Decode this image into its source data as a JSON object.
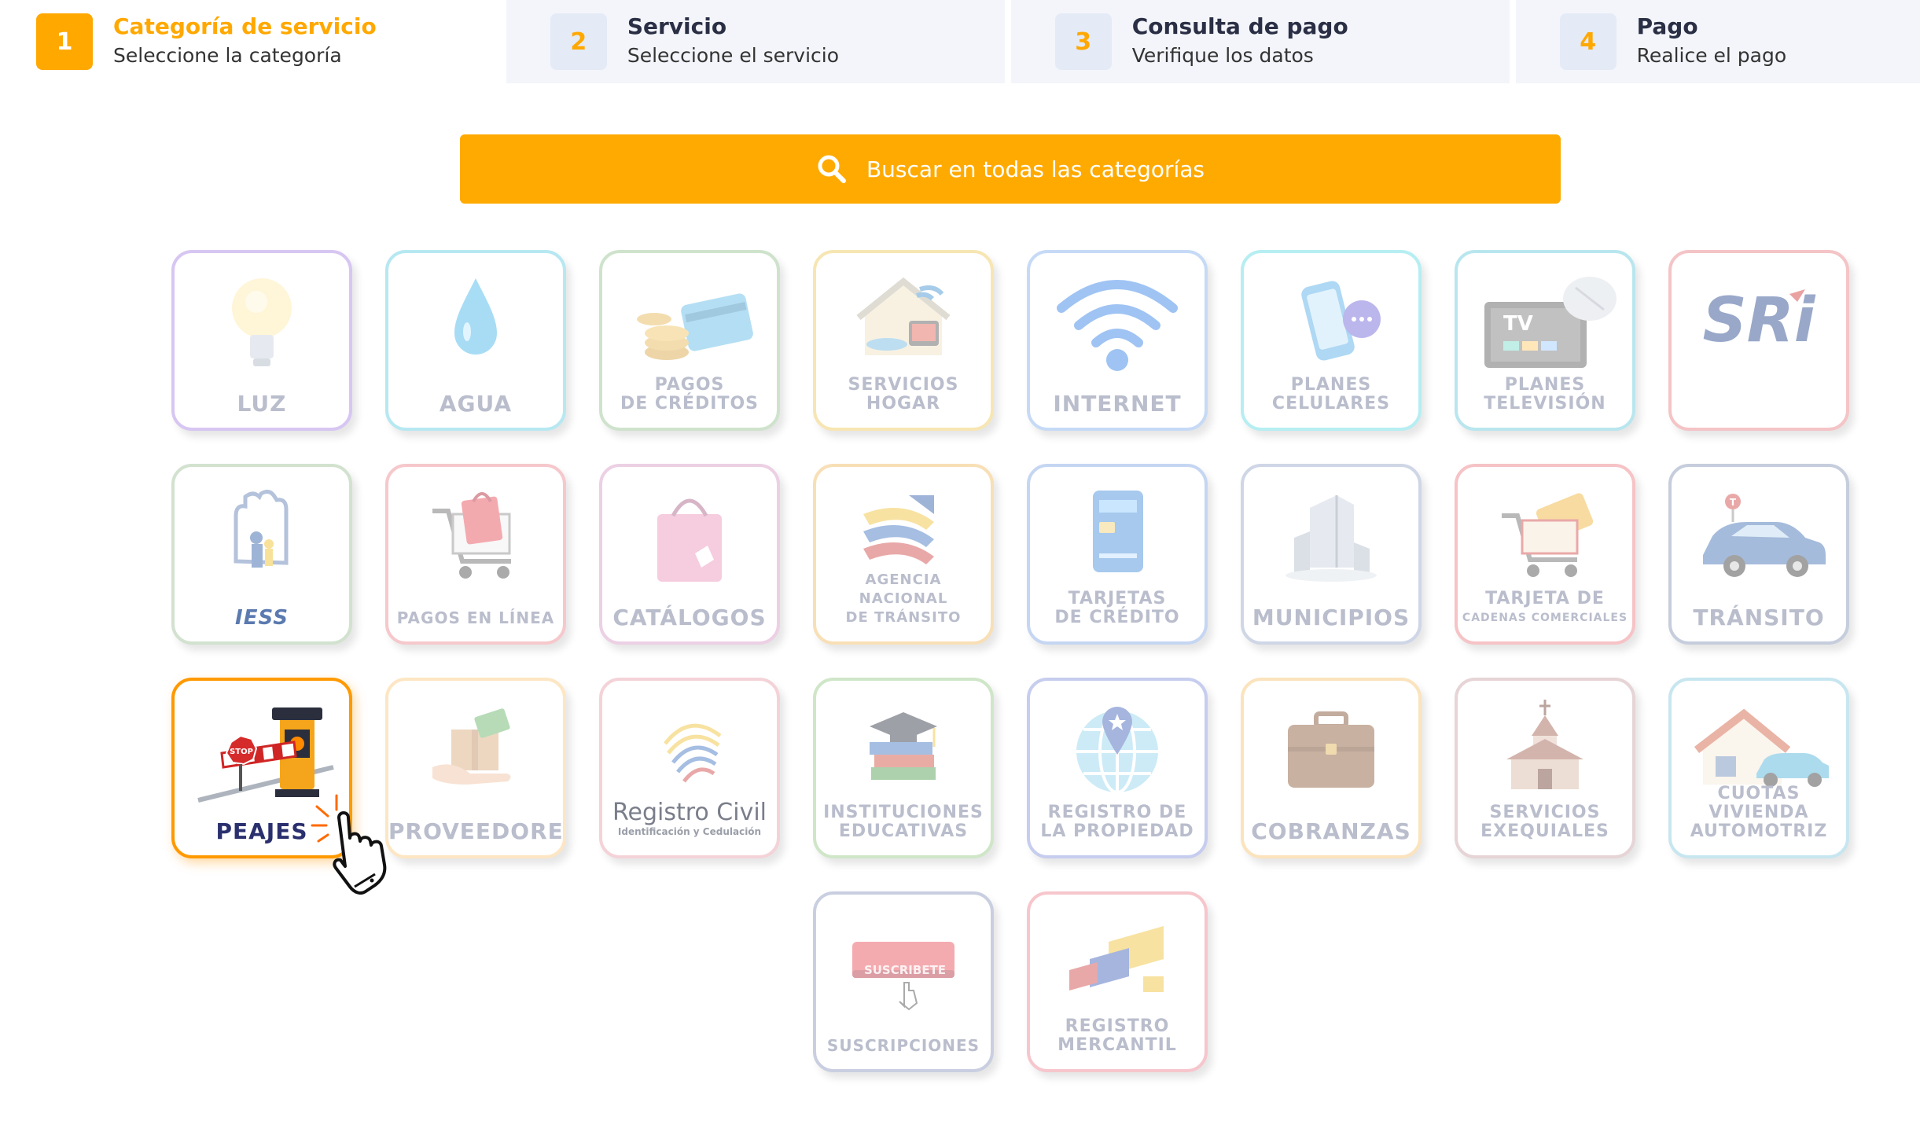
{
  "stepper": {
    "steps": [
      {
        "number": "1",
        "title": "Categoría de servicio",
        "subtitle": "Seleccione la categoría"
      },
      {
        "number": "2",
        "title": "Servicio",
        "subtitle": "Seleccione el servicio"
      },
      {
        "number": "3",
        "title": "Consulta de pago",
        "subtitle": "Verifique los datos"
      },
      {
        "number": "4",
        "title": "Pago",
        "subtitle": "Realice el pago"
      }
    ],
    "active_step": "1"
  },
  "search": {
    "placeholder": "Buscar en todas las categorías",
    "icon": "search-icon"
  },
  "colors": {
    "accent": "#ffa800",
    "search_bg": "#ffaa00",
    "selected_label": "#2a2f6e"
  },
  "categories": [
    {
      "id": "luz",
      "line1": "LUZ",
      "line2": "",
      "icon": "lightbulb-icon",
      "border": "#d7c6f2"
    },
    {
      "id": "agua",
      "line1": "AGUA",
      "line2": "",
      "icon": "water-drop-icon",
      "border": "#b7e8f2"
    },
    {
      "id": "pagos-creditos",
      "line1": "PAGOS",
      "line2": "DE CRÉDITOS",
      "icon": "coins-card-icon",
      "border": "#cfe3cc"
    },
    {
      "id": "servicios-hogar",
      "line1": "SERVICIOS",
      "line2": "HOGAR",
      "icon": "home-services-icon",
      "border": "#f7e6b3"
    },
    {
      "id": "internet",
      "line1": "INTERNET",
      "line2": "",
      "icon": "wifi-icon",
      "border": "#c6daf6"
    },
    {
      "id": "planes-celulares",
      "line1": "PLANES",
      "line2": "CELULARES",
      "icon": "phone-chat-icon",
      "border": "#b6eef2"
    },
    {
      "id": "planes-television",
      "line1": "PLANES",
      "line2": "TELEVISIÓN",
      "icon": "tv-satellite-icon",
      "border": "#b9e6ee"
    },
    {
      "id": "sri",
      "line1": "",
      "line2": "",
      "logo": "SRi",
      "icon": "sri-logo-icon",
      "border": "#f4c4c6"
    },
    {
      "id": "iess",
      "line1": "",
      "line2": "",
      "logo": "IESS",
      "icon": "iess-logo-icon",
      "border": "#d2e2cf"
    },
    {
      "id": "pagos-linea",
      "line1": "PAGOS EN LÍNEA",
      "line2": "",
      "icon": "shopping-cart-icon",
      "border": "#f6c8cc"
    },
    {
      "id": "catalogos",
      "line1": "CATÁLOGOS",
      "line2": "",
      "icon": "shopping-bag-icon",
      "border": "#ecd0e4"
    },
    {
      "id": "ant",
      "line1": "AGENCIA",
      "line2": "NACIONAL",
      "line3": "DE TRÁNSITO",
      "icon": "ant-logo-icon",
      "border": "#f8dfb6"
    },
    {
      "id": "tarjetas-credito",
      "line1": "TARJETAS",
      "line2": "DE CRÉDITO",
      "icon": "credit-card-icon",
      "border": "#c5d6f2"
    },
    {
      "id": "municipios",
      "line1": "MUNICIPIOS",
      "line2": "",
      "icon": "building-icon",
      "border": "#cfd6e6"
    },
    {
      "id": "tarjeta-cadenas",
      "line1": "TARJETA DE",
      "line2": "CADENAS COMERCIALES",
      "icon": "cart-card-icon",
      "border": "#f6c3c6"
    },
    {
      "id": "transito",
      "line1": "TRÁNSITO",
      "line2": "",
      "icon": "car-icon",
      "border": "#c6cddc"
    },
    {
      "id": "peajes",
      "line1": "PEAJES",
      "line2": "",
      "icon": "toll-barrier-icon",
      "border": "#ff9900",
      "selected": true
    },
    {
      "id": "proveedores",
      "line1": "PROVEEDORES",
      "line2": "",
      "icon": "box-hand-icon",
      "border": "#fde6c3"
    },
    {
      "id": "registro-civil",
      "line1": "",
      "line2": "",
      "logo": "Registro Civil",
      "logo_sub": "Identificación y Cedulación",
      "icon": "fingerprint-icon",
      "border": "#f4d3d8"
    },
    {
      "id": "instituciones-educativas",
      "line1": "INSTITUCIONES",
      "line2": "EDUCATIVAS",
      "icon": "graduation-books-icon",
      "border": "#cfe6c8"
    },
    {
      "id": "registro-propiedad",
      "line1": "REGISTRO DE",
      "line2": "LA PROPIEDAD",
      "icon": "globe-pin-icon",
      "border": "#c6cdee"
    },
    {
      "id": "cobranzas",
      "line1": "COBRANZAS",
      "line2": "",
      "icon": "briefcase-icon",
      "border": "#fbe3bd"
    },
    {
      "id": "servicios-exequiales",
      "line1": "SERVICIOS",
      "line2": "EXEQUIALES",
      "icon": "church-icon",
      "border": "#e6d4d6"
    },
    {
      "id": "cuotas-vivienda",
      "line1": "CUOTAS VIVIENDA",
      "line2": "AUTOMOTRIZ",
      "icon": "house-car-icon",
      "border": "#c7e6f0"
    },
    {
      "id": "suscripciones",
      "line1": "SUSCRIPCIONES",
      "line2": "",
      "badge": "SUSCRIBETE",
      "icon": "subscribe-button-icon",
      "border": "#c9cfe0"
    },
    {
      "id": "registro-mercantil",
      "line1": "REGISTRO",
      "line2": "MERCANTIL",
      "icon": "registro-mercantil-logo-icon",
      "border": "#f6c6cc"
    }
  ]
}
